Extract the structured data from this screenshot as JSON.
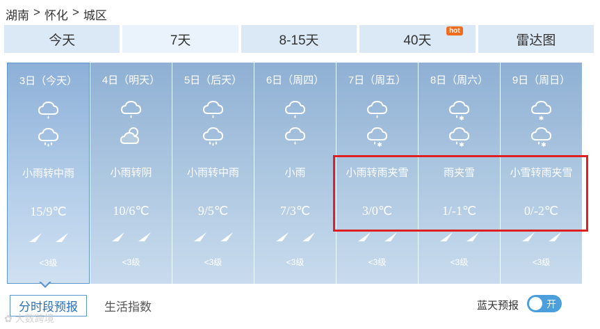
{
  "breadcrumb": {
    "province": "湖南",
    "city": "怀化",
    "district": "城区",
    "separator": ">"
  },
  "tabs": [
    {
      "label": "今天"
    },
    {
      "label": "7天"
    },
    {
      "label": "8-15天"
    },
    {
      "label": "40天",
      "badge": "hot"
    },
    {
      "label": "雷达图"
    }
  ],
  "days": [
    {
      "date": "3日（今天）",
      "icon_top": "light-rain-icon",
      "icon_bottom": "moderate-rain-icon",
      "weather": "小雨转中雨",
      "temp": "15/9℃",
      "wind_level": "<3级"
    },
    {
      "date": "4日（明天）",
      "icon_top": "light-rain-icon",
      "icon_bottom": "overcast-icon",
      "weather": "小雨转阴",
      "temp": "10/6℃",
      "wind_level": "<3级"
    },
    {
      "date": "5日（后天）",
      "icon_top": "light-rain-icon",
      "icon_bottom": "moderate-rain-icon",
      "weather": "小雨转中雨",
      "temp": "9/5℃",
      "wind_level": "<3级"
    },
    {
      "date": "6日（周四）",
      "icon_top": "light-rain-icon",
      "icon_bottom": "light-rain-icon",
      "weather": "小雨",
      "temp": "7/3℃",
      "wind_level": "<3级"
    },
    {
      "date": "7日（周五）",
      "icon_top": "light-rain-icon",
      "icon_bottom": "sleet-icon",
      "weather": "小雨转雨夹雪",
      "temp": "3/0℃",
      "wind_level": "<3级"
    },
    {
      "date": "8日（周六）",
      "icon_top": "sleet-icon",
      "icon_bottom": "sleet-icon",
      "weather": "雨夹雪",
      "temp": "1/-1℃",
      "wind_level": "<3级"
    },
    {
      "date": "9日（周日）",
      "icon_top": "light-snow-icon",
      "icon_bottom": "sleet-icon",
      "weather": "小雪转雨夹雪",
      "temp": "0/-2℃",
      "wind_level": "<3级"
    }
  ],
  "bottom_tabs": {
    "hourly": "分时段预报",
    "life_index": "生活指数"
  },
  "bluesky": {
    "label": "蓝天预报",
    "toggle": "开"
  },
  "watermark": "大数跨境",
  "colors": {
    "highlight": "#e02020",
    "tab_bg": "#dbe8f5",
    "toggle": "#4a9fdc"
  }
}
